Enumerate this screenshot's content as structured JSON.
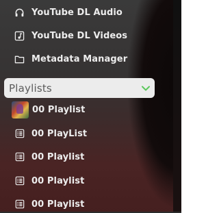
{
  "nav": {
    "items": [
      {
        "label": "YouTube DL Audio",
        "icon": "headphones-icon"
      },
      {
        "label": "YouTube DL Videos",
        "icon": "music-note-icon"
      },
      {
        "label": "Metadata Manager",
        "icon": "folder-icon"
      }
    ]
  },
  "playlists": {
    "header": "Playlists",
    "expanded": true,
    "chevron_color": "#5cc85c",
    "items": [
      {
        "label": "00 Playlist",
        "icon": "playlist-thumbnail"
      },
      {
        "label": "00 PlayList",
        "icon": "list-icon"
      },
      {
        "label": "00 Playlist",
        "icon": "list-icon"
      },
      {
        "label": "00 Playlist",
        "icon": "list-icon"
      },
      {
        "label": "00 Playlist",
        "icon": "list-icon"
      }
    ]
  }
}
